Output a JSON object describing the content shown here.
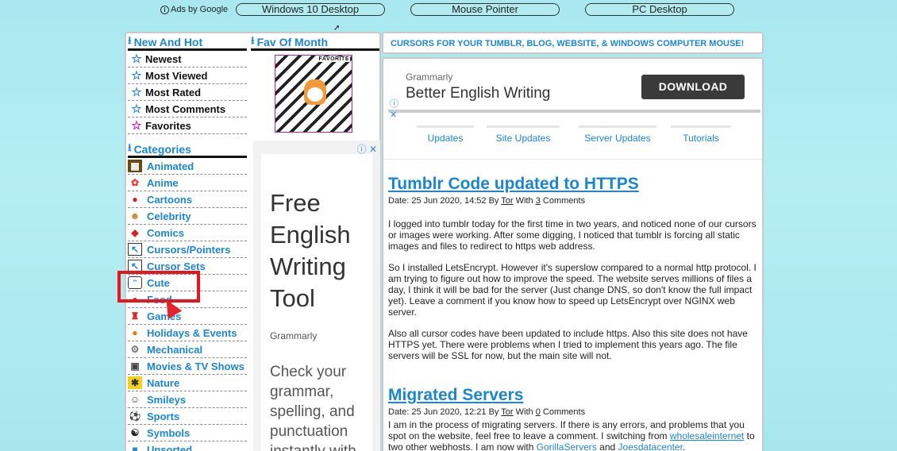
{
  "ad_bar": {
    "ads_by": "Ads by Google",
    "links": [
      "Windows 10 Desktop",
      "Mouse Pointer",
      "PC Desktop"
    ]
  },
  "sidebar": {
    "new_hot_title": "New And Hot",
    "fav_title": "Fav Of Month",
    "nav": [
      {
        "label": "Newest",
        "icon": "star-icon"
      },
      {
        "label": "Most Viewed",
        "icon": "star-icon"
      },
      {
        "label": "Most Rated",
        "icon": "star-icon"
      },
      {
        "label": "Most Comments",
        "icon": "star-icon"
      },
      {
        "label": "Favorites",
        "icon": "star-icon-pink"
      }
    ],
    "fav_badge": "FAVORITE",
    "categories_title": "Categories",
    "categories": [
      {
        "label": "Animated",
        "icon": "film-icon"
      },
      {
        "label": "Anime",
        "icon": "hello-kitty-icon"
      },
      {
        "label": "Cartoons",
        "icon": "cartoon-icon"
      },
      {
        "label": "Celebrity",
        "icon": "celebrity-icon"
      },
      {
        "label": "Comics",
        "icon": "superman-icon"
      },
      {
        "label": "Cursors/Pointers",
        "icon": "pointer-icon"
      },
      {
        "label": "Cursor Sets",
        "icon": "cursor-set-icon"
      },
      {
        "label": "Cute",
        "icon": "cute-face-icon"
      },
      {
        "label": "Food",
        "icon": "apple-icon"
      },
      {
        "label": "Games",
        "icon": "mario-icon"
      },
      {
        "label": "Holidays & Events",
        "icon": "pumpkin-icon"
      },
      {
        "label": "Mechanical",
        "icon": "gear-icon"
      },
      {
        "label": "Movies & TV Shows",
        "icon": "movie-icon"
      },
      {
        "label": "Nature",
        "icon": "nature-icon"
      },
      {
        "label": "Smileys",
        "icon": "smiley-icon"
      },
      {
        "label": "Sports",
        "icon": "soccer-ball-icon"
      },
      {
        "label": "Symbols",
        "icon": "yin-yang-icon"
      },
      {
        "label": "Unsorted",
        "icon": "unsorted-icon"
      }
    ]
  },
  "left_ad": {
    "headline": "Free English Writing Tool",
    "brand": "Grammarly",
    "body": "Check your grammar, spelling, and punctuation instantly with"
  },
  "banner": {
    "text": "CURSORS FOR YOUR TUMBLR, BLOG, WEBSITE, & WINDOWS COMPUTER MOUSE!"
  },
  "top_ad": {
    "brand": "Grammarly",
    "headline": "Better English Writing",
    "button": "DOWNLOAD"
  },
  "tabs": [
    "Updates",
    "Site Updates",
    "Server Updates",
    "Tutorials"
  ],
  "posts": [
    {
      "title": "Tumblr Code updated to HTTPS",
      "date": "Date: 25 Jun 2020, 14:52 By",
      "author": "Tor",
      "with": "With",
      "comments_count": "3",
      "comments_word": "Comments",
      "paragraphs": [
        "I logged into tumblr today for the first time in two years, and noticed none of our cursors or images were working. After some digging, I noticed that tumblr is forcing all static images and files to redirect to https web address.",
        "So I installed LetsEncrypt. However it's superslow compared to a normal http protocol. I am trying to figure out how to improve the speed. The website serves millions of files a day, I think it will be bad for the server (Just change DNS, so don't know the full impact yet). Leave a comment if you know how to speed up LetsEncrypt over NGINX web server.",
        "Also all cursor codes have been updated to include https. Also this site does not have HTTPS yet. There were problems when I tried to implement this years ago. The file servers will be SSL for now, but the main site will not."
      ]
    },
    {
      "title": "Migrated Servers",
      "date": "Date: 25 Jun 2020, 12:21 By",
      "author": "Tor",
      "with": "With",
      "comments_count": "0",
      "comments_word": "Comments",
      "p1_before": "I am in the process of migrating servers. If there is any errors, and problems that you spot on the website, feel free to leave a comment. I switching from",
      "link1": "wholesaleinternet",
      "p1_mid": "to two other webhosts. I am now with",
      "link2": "GorillaServers",
      "p1_and": "and",
      "link3": "Joesdatacenter",
      "p1_end": "."
    }
  ]
}
